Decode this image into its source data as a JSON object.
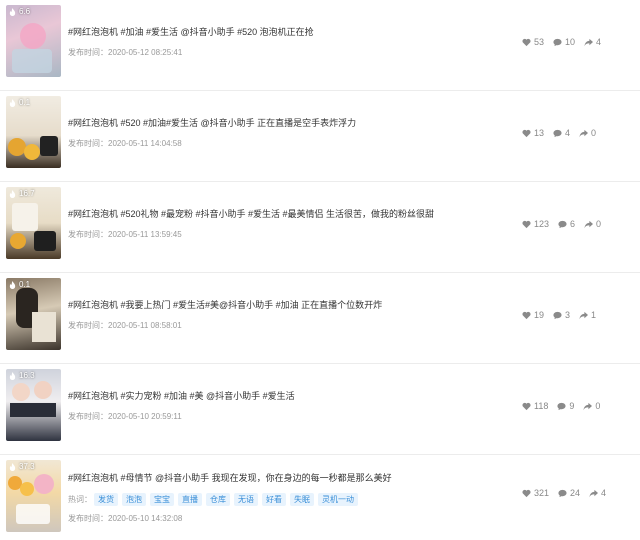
{
  "videos": [
    {
      "plays": "6.6",
      "title": "#网红泡泡机 #加油 #爱生活 @抖音小助手 #520 泡泡机正在抢",
      "time_label": "发布时间：",
      "time": "2020-05-12 08:25:41",
      "likes": "53",
      "comments": "10",
      "shares": "4"
    },
    {
      "plays": "0.1",
      "title": "#网红泡泡机 #520 #加油#爱生活 @抖音小助手 正在直播是空手表炸浮力",
      "time_label": "发布时间：",
      "time": "2020-05-11 14:04:58",
      "likes": "13",
      "comments": "4",
      "shares": "0"
    },
    {
      "plays": "16.7",
      "title": "#网红泡泡机 #520礼物 #最宠粉 #抖音小助手 #爱生活 #最美情侣 生活很苦，做我的粉丝很甜",
      "time_label": "发布时间：",
      "time": "2020-05-11 13:59:45",
      "likes": "123",
      "comments": "6",
      "shares": "0"
    },
    {
      "plays": "0.1",
      "title": "#网红泡泡机 #我要上热门 #爱生活#美@抖音小助手 #加油 正在直播个位数开炸",
      "time_label": "发布时间：",
      "time": "2020-05-11 08:58:01",
      "likes": "19",
      "comments": "3",
      "shares": "1"
    },
    {
      "plays": "16.3",
      "title": "#网红泡泡机 #实力宠粉 #加油 #美 @抖音小助手 #爱生活",
      "time_label": "发布时间：",
      "time": "2020-05-10 20:59:11",
      "likes": "118",
      "comments": "9",
      "shares": "0"
    },
    {
      "plays": "37.3",
      "title": "#网红泡泡机 #母情节 @抖音小助手 我现在发现，你在身边的每一秒都是那么美好",
      "hotword_label": "热词：",
      "hotwords": [
        "发货",
        "泡泡",
        "宝宝",
        "直播",
        "仓库",
        "无语",
        "好看",
        "失眠",
        "灵机一动"
      ],
      "time_label": "发布时间：",
      "time": "2020-05-10 14:32:08",
      "likes": "321",
      "comments": "24",
      "shares": "4"
    }
  ],
  "icons": {
    "plays": "fire-icon",
    "likes": "heart-icon",
    "comments": "comment-icon",
    "shares": "share-arrow-icon"
  },
  "colors": {
    "tag_bg": "#e8f3fd",
    "tag_text": "#3a8fd8",
    "meta_text": "#999999",
    "title_text": "#333333"
  }
}
